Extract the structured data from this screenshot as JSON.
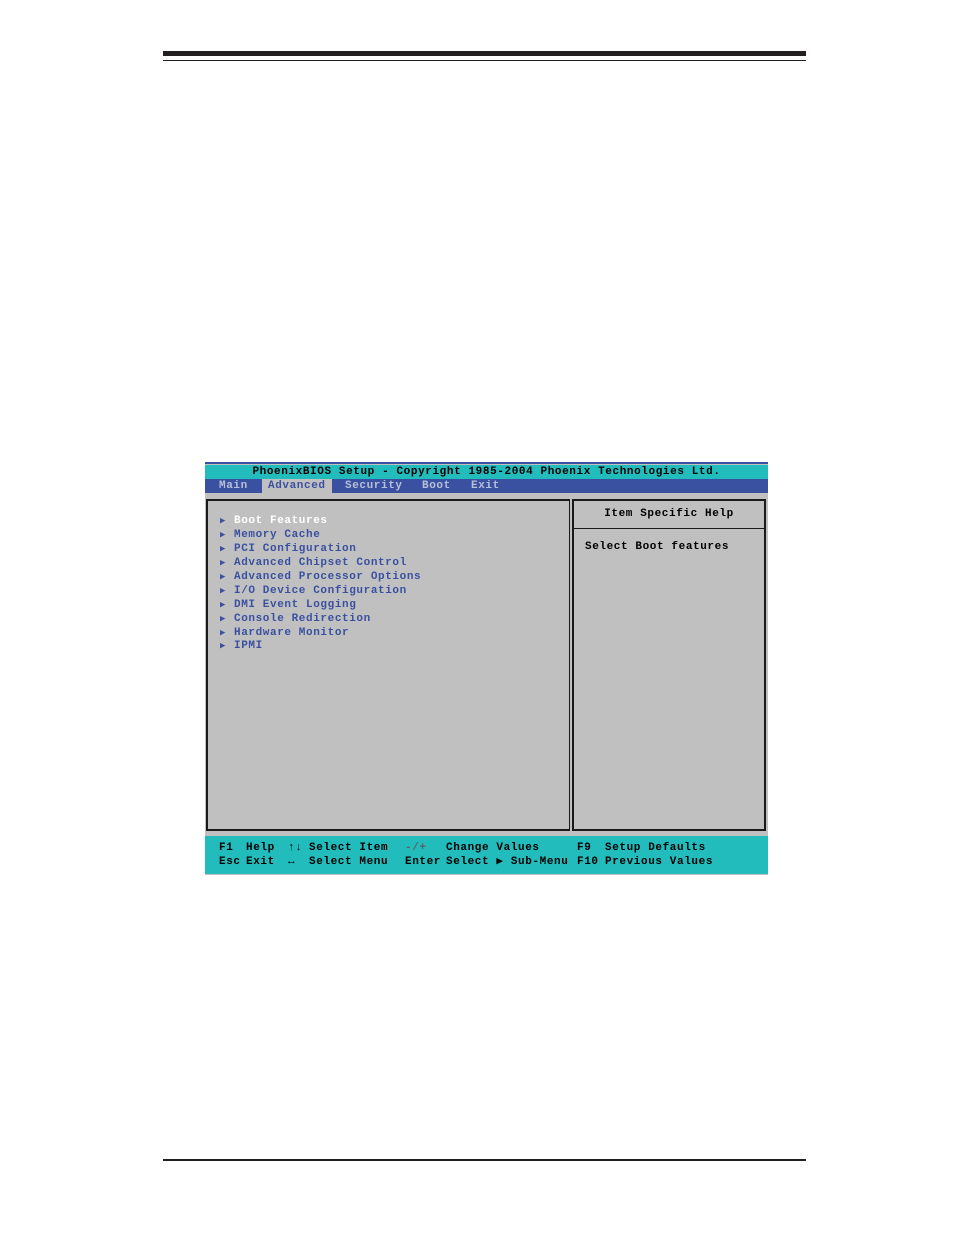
{
  "bios": {
    "title": "PhoenixBIOS Setup - Copyright 1985-2004 Phoenix Technologies Ltd.",
    "menu": [
      {
        "label": "Main",
        "active": false
      },
      {
        "label": "Advanced",
        "active": true
      },
      {
        "label": "Security",
        "active": false
      },
      {
        "label": "Boot",
        "active": false
      },
      {
        "label": "Exit",
        "active": false
      }
    ],
    "items": [
      {
        "label": "Boot Features",
        "selected": true
      },
      {
        "label": "Memory Cache"
      },
      {
        "label": "PCI Configuration"
      },
      {
        "label": "Advanced Chipset Control"
      },
      {
        "label": "Advanced Processor Options"
      },
      {
        "label": "I/O Device Configuration"
      },
      {
        "label": "DMI Event Logging"
      },
      {
        "label": "Console Redirection"
      },
      {
        "label": "Hardware Monitor"
      },
      {
        "label": "IPMI"
      }
    ],
    "arrow_icon": "▶",
    "help": {
      "header": "Item Specific Help",
      "text": "Select Boot features"
    },
    "footer": {
      "row1": [
        {
          "key": "F1",
          "desc": "Help"
        },
        {
          "key": "↑↓",
          "desc": "Select Item"
        },
        {
          "key": "-/+",
          "desc": "Change Values"
        },
        {
          "key": "F9",
          "desc": "Setup Defaults"
        }
      ],
      "row2": [
        {
          "key": "Esc",
          "desc": "Exit"
        },
        {
          "key": "↔",
          "desc": "Select Menu"
        },
        {
          "key": "Enter",
          "desc": "Select ▶ Sub-Menu"
        },
        {
          "key": "F10",
          "desc": "Previous Values"
        }
      ]
    },
    "colors": {
      "title_bg": "#22bcbc",
      "menu_bg": "#3a50a0",
      "panel_bg": "#c0c0c0",
      "item_text": "#3a50a0",
      "selected_text": "#ffffff"
    }
  }
}
